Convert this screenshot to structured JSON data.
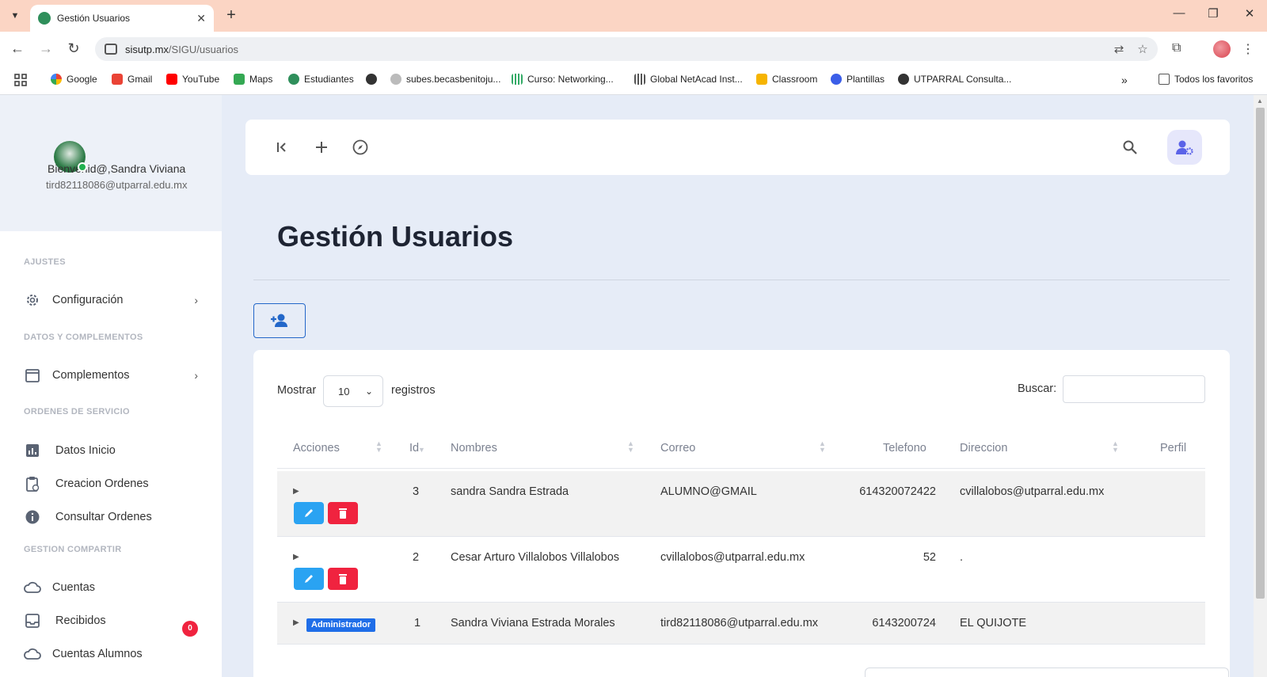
{
  "browser": {
    "tab_title": "Gestión Usuarios",
    "url_host": "sisutp.mx",
    "url_path": "/SIGU/usuarios",
    "bookmarks": [
      "Google",
      "Gmail",
      "YouTube",
      "Maps",
      "Estudiantes",
      "subes.becasbenitoju...",
      "Curso: Networking...",
      "Global NetAcad Inst...",
      "Classroom",
      "Plantillas",
      "UTPARRAL Consulta..."
    ],
    "all_bookmarks": "Todos los favoritos"
  },
  "sidebar": {
    "welcome": "Bienvenid@,Sandra Viviana",
    "email": "tird82118086@utparral.edu.mx",
    "sections": [
      "AJUSTES",
      "DATOS Y COMPLEMENTOS",
      "ORDENES DE SERVICIO",
      "GESTION COMPARTIR"
    ],
    "items": [
      {
        "label": "Configuración",
        "icon": "gear-icon"
      },
      {
        "label": "Complementos",
        "icon": "calendar-icon"
      },
      {
        "label": "Datos Inicio",
        "icon": "chart-icon"
      },
      {
        "label": "Creacion Ordenes",
        "icon": "clipboard-icon"
      },
      {
        "label": "Consultar Ordenes",
        "icon": "info-icon"
      },
      {
        "label": "Cuentas",
        "icon": "cloud-icon"
      },
      {
        "label": "Recibidos",
        "icon": "inbox-icon"
      },
      {
        "label": "Cuentas Alumnos",
        "icon": "cloud-icon"
      }
    ],
    "recibidos_badge": "0"
  },
  "main": {
    "title": "Gestión Usuarios",
    "show_label": "Mostrar",
    "page_size": "10",
    "records_label": "registros",
    "search_label": "Buscar:",
    "columns": [
      "Acciones",
      "Id",
      "Nombres",
      "Correo",
      "Telefono",
      "Direccion",
      "Perfil"
    ],
    "rows": [
      {
        "id": "3",
        "nombres": "sandra Sandra Estrada",
        "correo": "ALUMNO@GMAIL",
        "telefono": "614320072422",
        "direccion": "cvillalobos@utparral.edu.mx",
        "perfil": ""
      },
      {
        "id": "2",
        "nombres": "Cesar Arturo Villalobos Villalobos",
        "correo": "cvillalobos@utparral.edu.mx",
        "telefono": "52",
        "direccion": ".",
        "perfil": ""
      },
      {
        "id": "1",
        "nombres": "Sandra Viviana Estrada Morales",
        "correo": "tird82118086@utparral.edu.mx",
        "telefono": "6143200724",
        "direccion": "EL QUIJOTE",
        "perfil": "",
        "badge": "Administrador"
      }
    ]
  },
  "colors": {
    "accent": "#2367c9",
    "edit": "#2aa3f2",
    "delete": "#f0233f",
    "tab_strip": "#fbd5c4",
    "page_bg": "#e6ecf7"
  }
}
